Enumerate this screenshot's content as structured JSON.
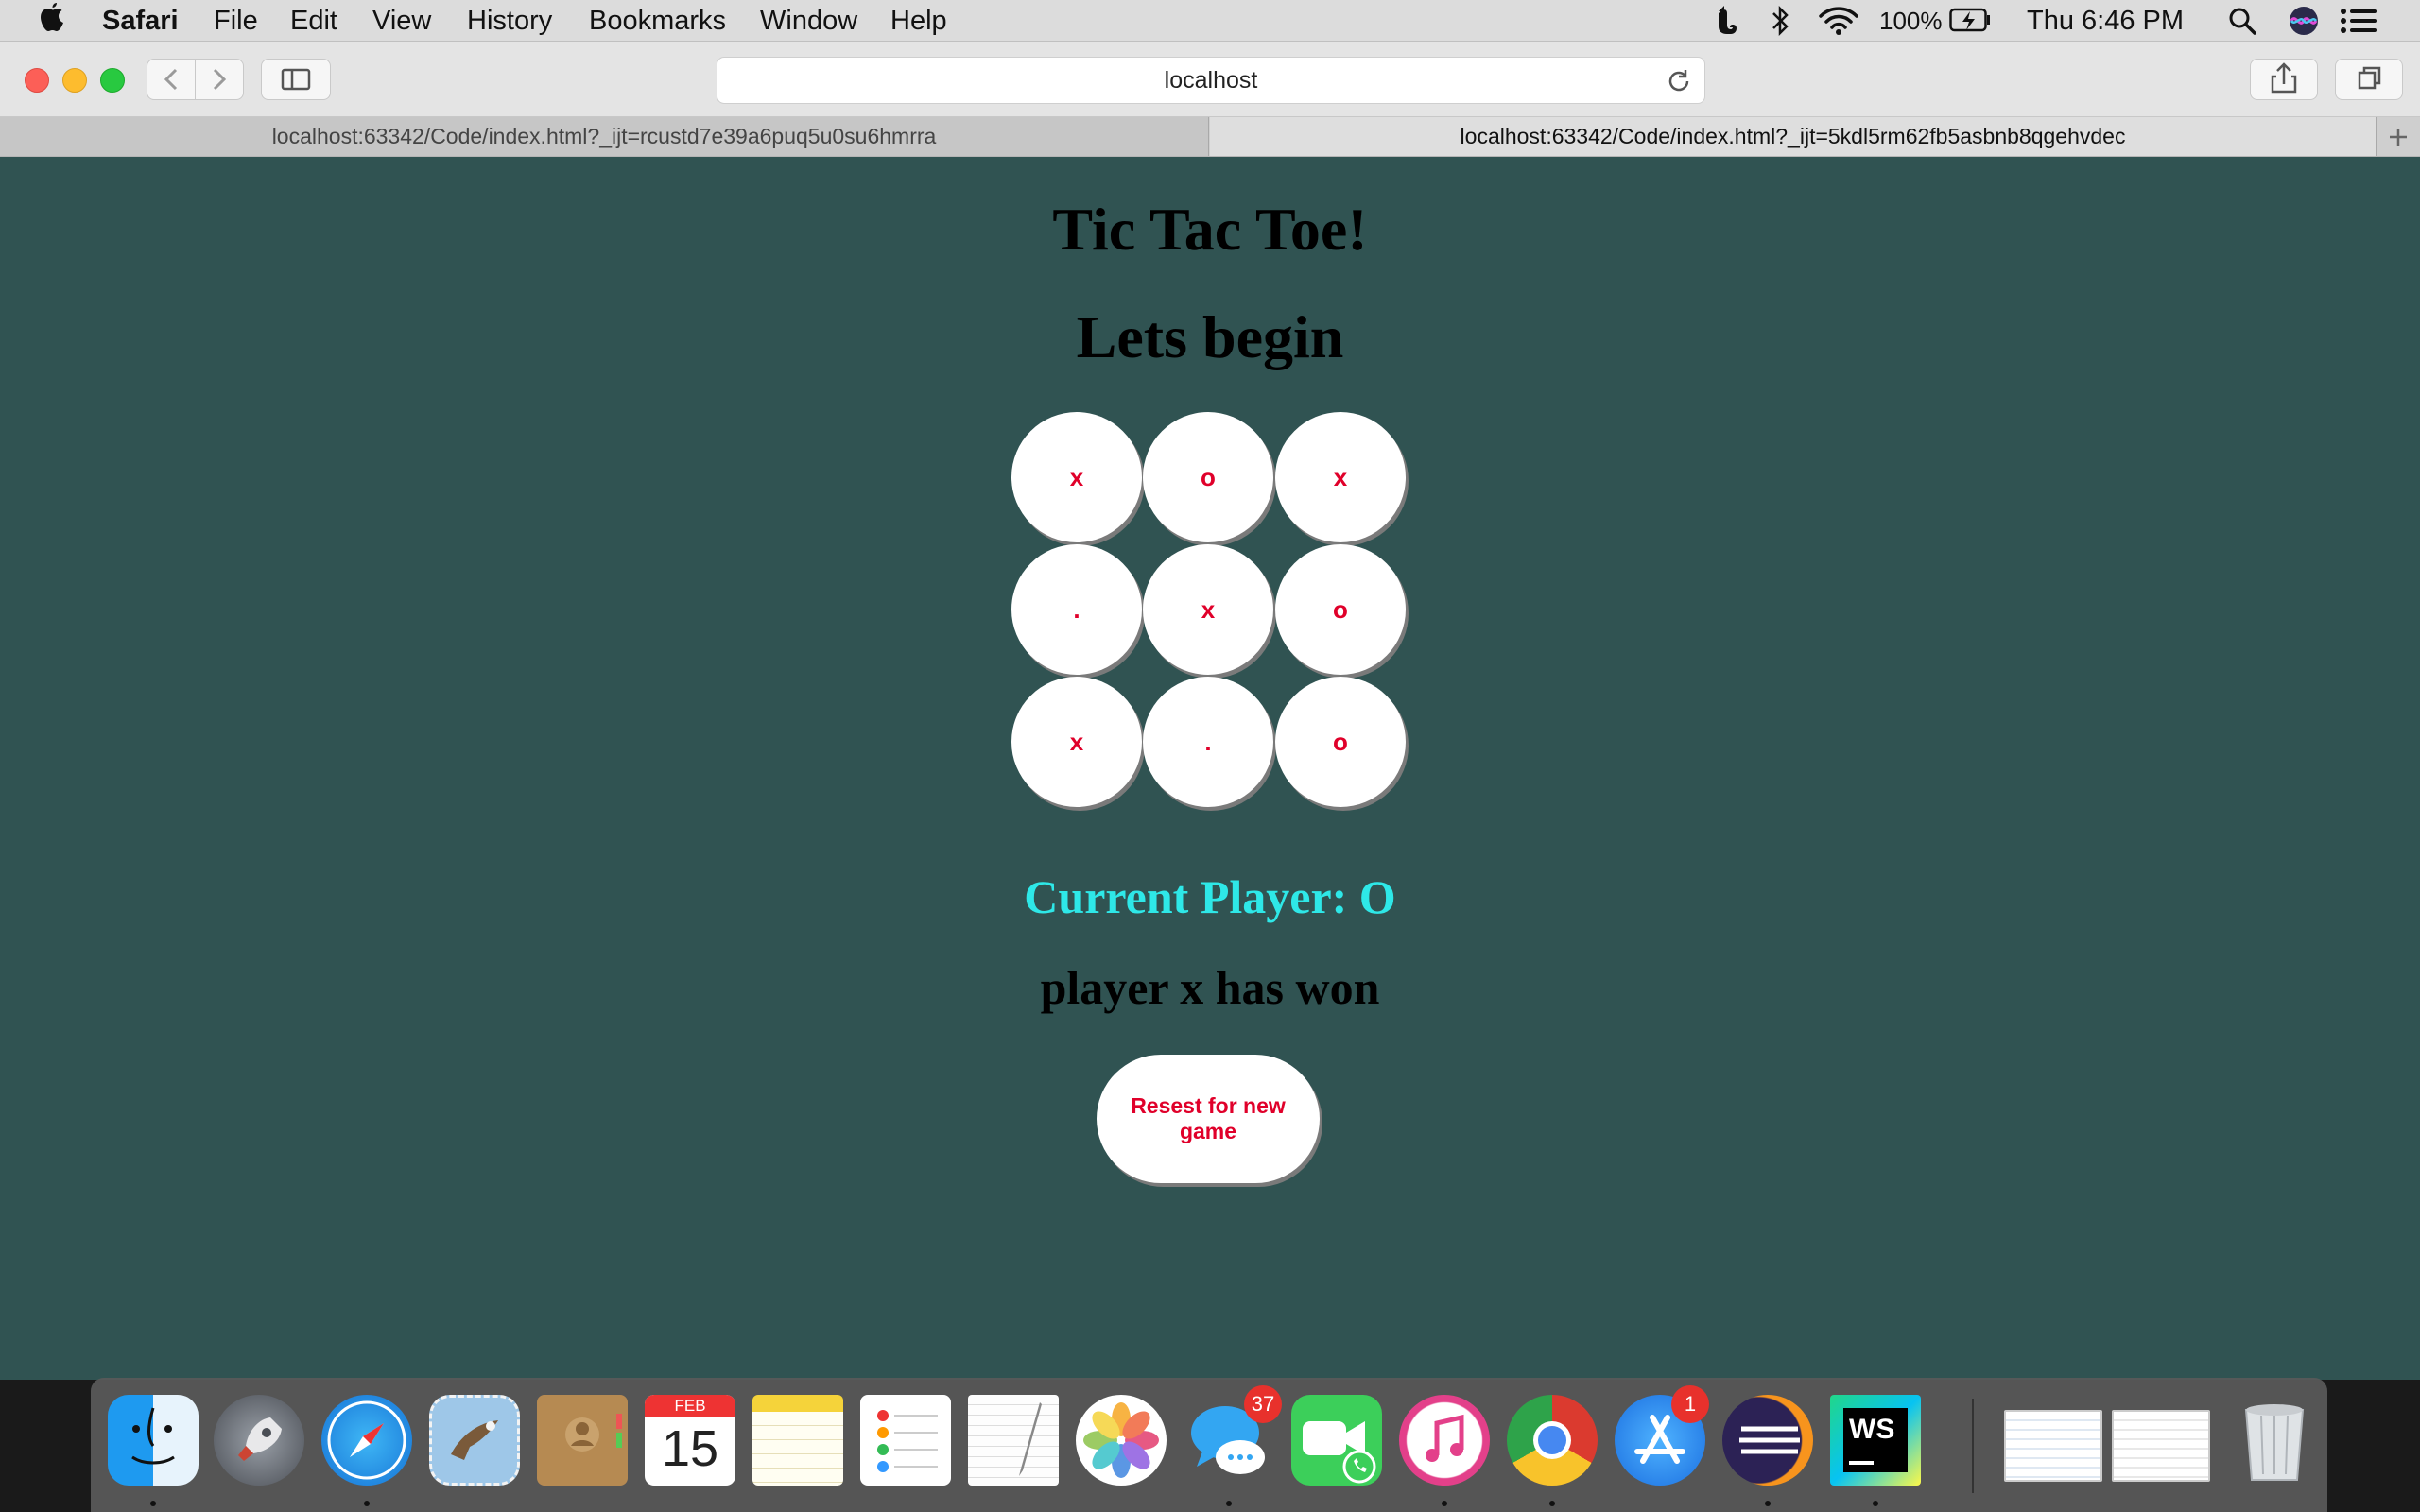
{
  "menubar": {
    "app_name": "Safari",
    "menus": [
      "File",
      "Edit",
      "View",
      "History",
      "Bookmarks",
      "Window",
      "Help"
    ],
    "battery": "100%",
    "clock": "Thu 6:46 PM"
  },
  "toolbar": {
    "address": "localhost"
  },
  "tabs": [
    {
      "label": "localhost:63342/Code/index.html?_ijt=rcustd7e39a6puq5u0su6hmrra",
      "active": false
    },
    {
      "label": "localhost:63342/Code/index.html?_ijt=5kdl5rm62fb5asbnb8qgehvdec",
      "active": true
    }
  ],
  "game": {
    "title": "Tic Tac Toe!",
    "subtitle": "Lets begin",
    "board": [
      "x",
      "o",
      "x",
      ".",
      "x",
      "o",
      "x",
      ".",
      "o"
    ],
    "current_player": "Current Player: O",
    "status": "player x has won",
    "reset_label": "Resest for new game"
  },
  "dock": {
    "calendar_month": "FEB",
    "calendar_day": "15",
    "messages_badge": "37",
    "appstore_badge": "1",
    "webstorm_label": "WS",
    "icons": [
      "finder-icon",
      "launchpad-icon",
      "safari-icon",
      "mail-icon",
      "contacts-icon",
      "calendar-icon",
      "notes-icon",
      "reminders-icon",
      "textedit-icon",
      "photos-icon",
      "messages-icon",
      "facetime-icon",
      "itunes-icon",
      "chrome-icon",
      "appstore-icon",
      "eclipse-icon",
      "webstorm-icon",
      "preview-icon",
      "preview-icon",
      "trash-icon"
    ]
  },
  "colors": {
    "page_bg": "#305352",
    "current_player_color": "#2ee8e8",
    "mark_color": "#e0002a"
  }
}
